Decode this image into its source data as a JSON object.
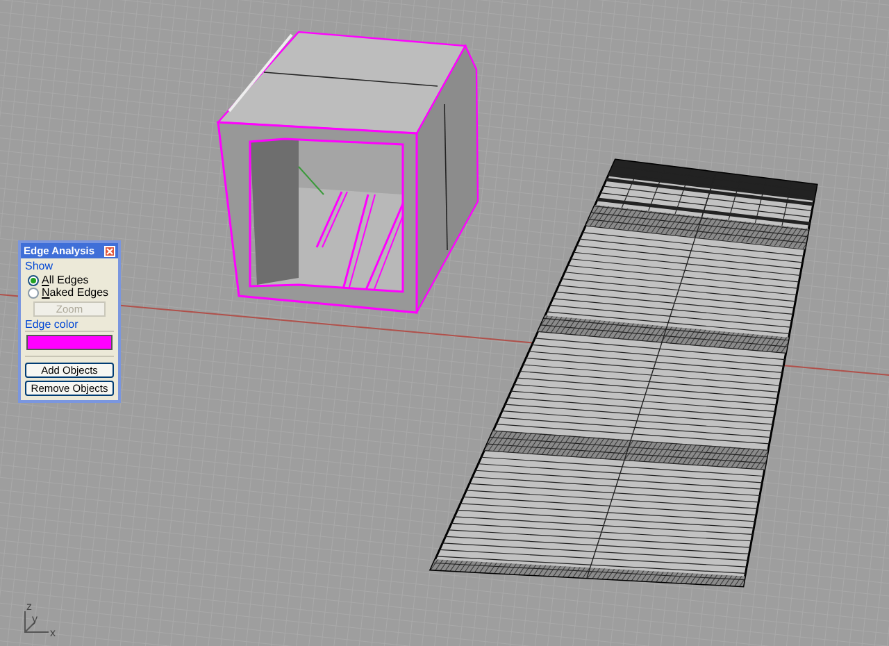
{
  "viewport": {
    "axis_labels": [
      "z",
      "y",
      "x"
    ]
  },
  "dialog": {
    "title": "Edge Analysis",
    "show_label": "Show",
    "options": [
      {
        "label": "All Edges",
        "selected": true
      },
      {
        "label": "Naked Edges",
        "selected": false
      }
    ],
    "zoom_button": {
      "label": "Zoom",
      "disabled": true
    },
    "edge_color": {
      "label": "Edge color",
      "color": "#ff00ff"
    },
    "buttons": [
      "Add Objects",
      "Remove Objects"
    ]
  }
}
